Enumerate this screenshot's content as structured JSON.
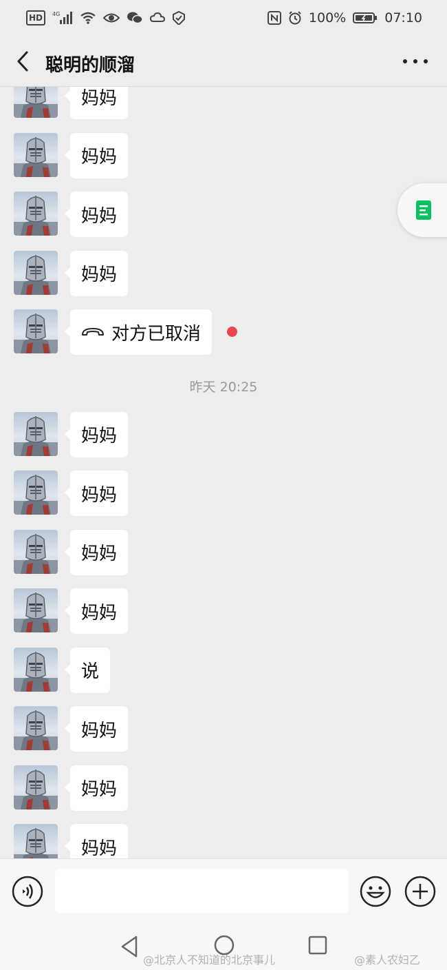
{
  "status_bar": {
    "network": "4G",
    "battery": "100%",
    "time": "07:10"
  },
  "header": {
    "title": "聪明的顺溜",
    "back_icon": "chevron-left-icon",
    "more_icon": "more-dots-icon"
  },
  "messages_before": [
    {
      "text": "妈妈"
    },
    {
      "text": "妈妈"
    },
    {
      "text": "妈妈"
    },
    {
      "text": "妈妈"
    }
  ],
  "call_message": {
    "text": "对方已取消",
    "icon": "phone-hangup-icon",
    "unread": true
  },
  "timestamp": "昨天 20:25",
  "messages_after": [
    {
      "text": "妈妈"
    },
    {
      "text": "妈妈"
    },
    {
      "text": "妈妈"
    },
    {
      "text": "妈妈"
    },
    {
      "text": "说"
    },
    {
      "text": "妈妈"
    },
    {
      "text": "妈妈"
    },
    {
      "text": "妈妈"
    }
  ],
  "input_bar": {
    "voice_icon": "voice-icon",
    "text_value": "",
    "emoji_icon": "emoji-icon",
    "plus_icon": "plus-icon"
  },
  "watermarks": [
    "@北京人不知道的北京事儿",
    "@素人农妇乙"
  ],
  "colors": {
    "background": "#ededed",
    "bubble": "#ffffff",
    "unread_dot": "#e8484d",
    "accent_green": "#07c160"
  }
}
